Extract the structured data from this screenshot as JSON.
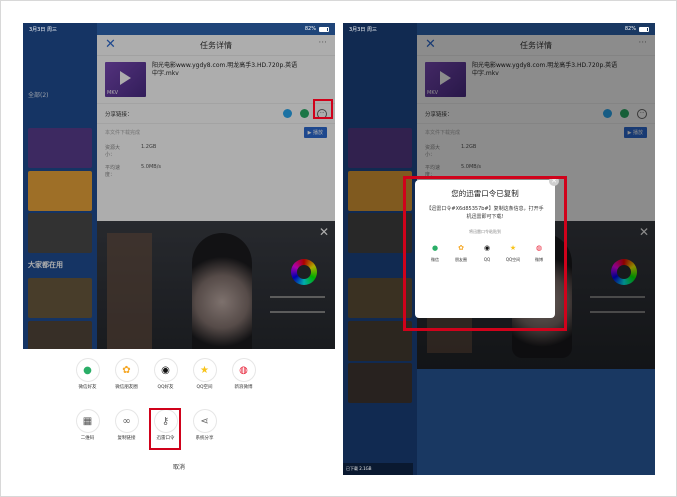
{
  "statusbar": {
    "time": "3月3日 周三",
    "battery": "82%"
  },
  "left_screen": {
    "bg_tab": "全部(2)",
    "bg_section": "大家都在用",
    "panel": {
      "title": "任务详情",
      "movie_title": "阳光电影www.ygdy8.com.明龙高手3.HD.720p.英语中字.mkv",
      "thumb_label": "MKV",
      "share_label": "分享链接：",
      "download_hint": "本文件下载完成",
      "download_btn": "▶ 播放",
      "size_key": "资源大小：",
      "size_value": "1.2GB",
      "speed_key": "平均速度：",
      "speed_value": "5.0MB/s"
    },
    "sheet": {
      "row1": [
        {
          "label": "微信好友",
          "icon": "wechat-icon",
          "color": "#2aae67",
          "glyph": "●"
        },
        {
          "label": "微信朋友圈",
          "icon": "moments-icon",
          "color": "#f5a623",
          "glyph": "✿"
        },
        {
          "label": "QQ好友",
          "icon": "qq-icon",
          "color": "#111111",
          "glyph": "◉"
        },
        {
          "label": "QQ空间",
          "icon": "qzone-icon",
          "color": "#f8c41b",
          "glyph": "★"
        },
        {
          "label": "新浪微博",
          "icon": "weibo-icon",
          "color": "#e6162d",
          "glyph": "◍"
        }
      ],
      "row2": [
        {
          "label": "二维码",
          "icon": "qrcode-icon",
          "color": "#555555",
          "glyph": "▦"
        },
        {
          "label": "复制链接",
          "icon": "link-icon",
          "color": "#666666",
          "glyph": "∞"
        },
        {
          "label": "迅雷口令",
          "icon": "key-icon",
          "color": "#666666",
          "glyph": "⚷"
        },
        {
          "label": "系统分享",
          "icon": "share-icon",
          "color": "#666666",
          "glyph": "⋖"
        }
      ],
      "cancel": "取消"
    }
  },
  "right_screen": {
    "popup": {
      "title": "您的迅雷口令已复制",
      "body": "【迅雷口令#X6d85357b#】复制这条信息，打开手机迅雷即可下载!",
      "hint": "将迅雷口令粘贴到",
      "targets": [
        {
          "label": "微信",
          "icon": "wechat-icon",
          "color": "#2aae67",
          "glyph": "●"
        },
        {
          "label": "朋友圈",
          "icon": "moments-icon",
          "color": "#f5a623",
          "glyph": "✿"
        },
        {
          "label": "QQ",
          "icon": "qq-icon",
          "color": "#111111",
          "glyph": "◉"
        },
        {
          "label": "QQ空间",
          "icon": "qzone-icon",
          "color": "#f8c41b",
          "glyph": "★"
        },
        {
          "label": "微博",
          "icon": "weibo-icon",
          "color": "#e6162d",
          "glyph": "◍"
        }
      ]
    },
    "bottom_bar": "已下载 2.1GB"
  },
  "colors": {
    "highlight": "#d0021b",
    "accent": "#2d6bd1",
    "bg_blue": "#2f66b3"
  }
}
